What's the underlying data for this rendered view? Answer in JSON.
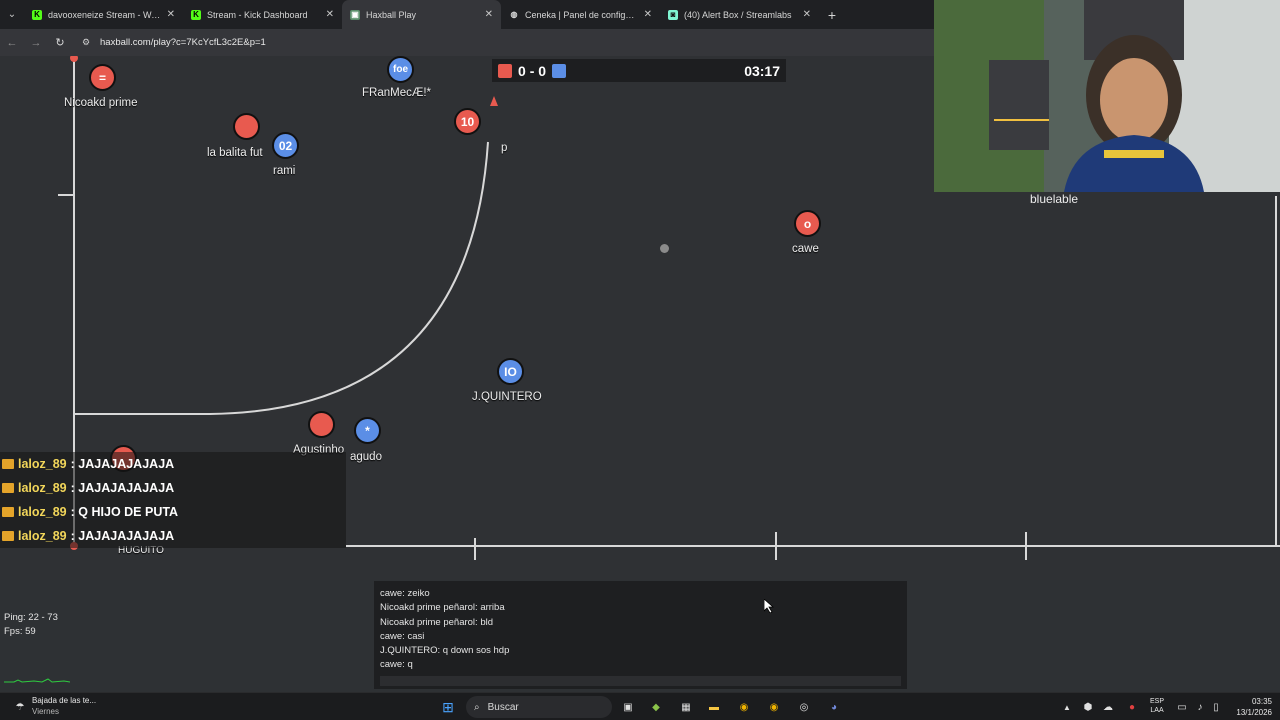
{
  "browser": {
    "tabs": [
      {
        "title": "davooxeneize Stream - Watch li",
        "icon": "kick-icon",
        "active": false
      },
      {
        "title": "Stream - Kick Dashboard",
        "icon": "kick-icon",
        "active": false
      },
      {
        "title": "Haxball Play",
        "icon": "haxball-icon",
        "active": true
      },
      {
        "title": "Ceneka | Panel de configuración",
        "icon": "globe-icon",
        "active": false
      },
      {
        "title": "(40) Alert Box / Streamlabs",
        "icon": "streamlabs-icon",
        "active": false
      }
    ],
    "url": "haxball.com/play?c=7KcYcfL3c2E&p=1"
  },
  "scoreboard": {
    "red_score": "0",
    "separator": "-",
    "blue_score": "0",
    "time": "03:17"
  },
  "players": [
    {
      "team": "red",
      "badge": "=",
      "name": "Nicoakd prime"
    },
    {
      "team": "blue",
      "badge": "foe",
      "name": "FRanMecÆ!*"
    },
    {
      "team": "red",
      "badge": "",
      "name": "la balita fut"
    },
    {
      "team": "blue",
      "badge": "02",
      "name": "rami"
    },
    {
      "team": "red",
      "badge": "10",
      "name": "p"
    },
    {
      "team": "red",
      "badge": "o",
      "name": "cawe"
    },
    {
      "team": "blue",
      "badge": "IO",
      "name": "J.QUINTERO"
    },
    {
      "team": "red",
      "badge": "",
      "name": "Agustinho"
    },
    {
      "team": "blue",
      "badge": "*",
      "name": "agudo"
    },
    {
      "team": "red",
      "badge": "",
      "name": "HUGUITO"
    }
  ],
  "stream_chat": [
    {
      "user": "laloz_89",
      "sep": ":",
      "message": "JAJAJAJAJAJA"
    },
    {
      "user": "laloz_89",
      "sep": ":",
      "message": "JAJAJAJAJAJA"
    },
    {
      "user": "laloz_89",
      "sep": ":",
      "message": "Q HIJO DE PUTA"
    },
    {
      "user": "laloz_89",
      "sep": ":",
      "message": "JAJAJAJAJAJA"
    }
  ],
  "game_chat": [
    "cawe: zeiko",
    "Nicoakd prime peñarol: arriba",
    "Nicoakd prime peñarol: bld",
    "cawe: casi",
    "J.QUINTERO: q down sos hdp",
    "cawe: q"
  ],
  "stats": {
    "ping": "Ping: 22 - 73",
    "fps": "Fps: 59"
  },
  "webcam": {
    "username": "bluelable"
  },
  "taskbar": {
    "weather_title": "Bajada de las te...",
    "weather_sub": "Viernes",
    "search_placeholder": "Buscar",
    "lang_top": "ESP",
    "lang_bottom": "LAA",
    "time": "03:35",
    "date": "13/1/2026"
  },
  "colors": {
    "red_team": "#e85a4f",
    "blue_team": "#5b8ee6",
    "chat_user": "#f2d65a"
  }
}
